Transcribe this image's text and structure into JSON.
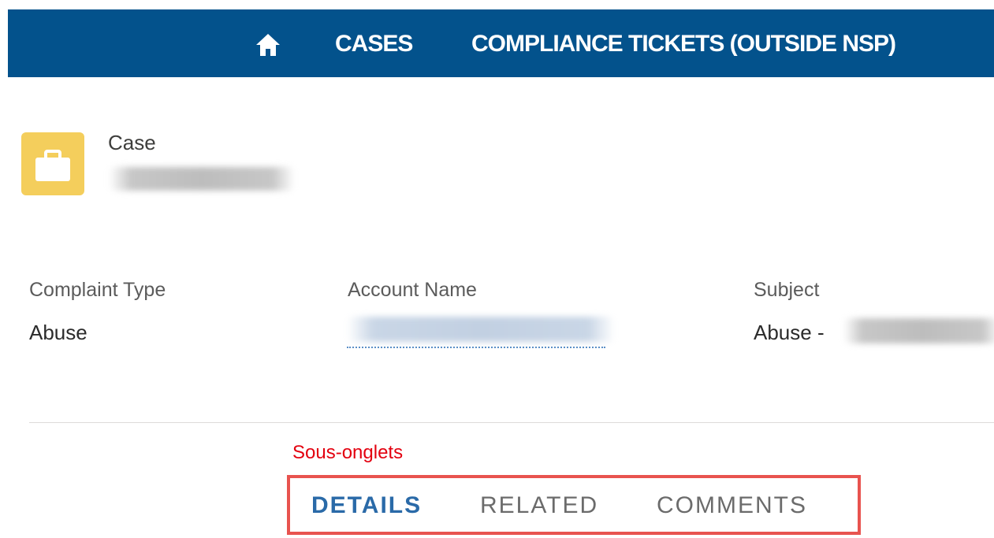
{
  "nav": {
    "items": [
      {
        "label": "CASES"
      },
      {
        "label": "COMPLIANCE TICKETS (OUTSIDE NSP)"
      }
    ]
  },
  "record": {
    "type_label": "Case",
    "icon": "briefcase-icon"
  },
  "highlights": {
    "fields": [
      {
        "label": "Complaint Type",
        "value": "Abuse"
      },
      {
        "label": "Account Name",
        "value": ""
      },
      {
        "label": "Subject",
        "value": "Abuse -"
      }
    ]
  },
  "annotation": {
    "text": "Sous-onglets"
  },
  "tabs": [
    {
      "label": "DETAILS",
      "active": true
    },
    {
      "label": "RELATED",
      "active": false
    },
    {
      "label": "COMMENTS",
      "active": false
    }
  ],
  "colors": {
    "nav_bg": "#03528c",
    "icon_bg": "#f4ce5c",
    "active_tab": "#2a6aa8",
    "annotation_red": "#e3000f"
  }
}
